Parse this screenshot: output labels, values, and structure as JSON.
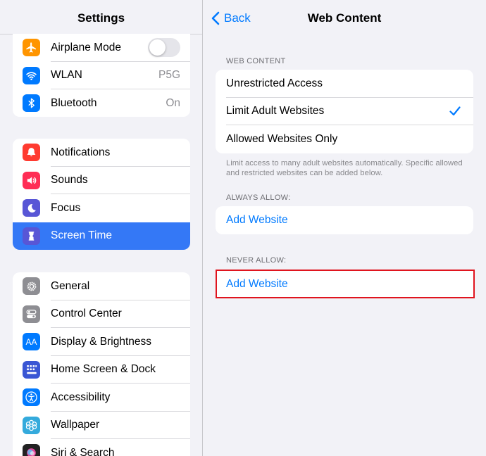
{
  "sidebar": {
    "title": "Settings",
    "groups": [
      {
        "items": [
          {
            "label": "Airplane Mode",
            "icon": "airplane-icon",
            "color": "#ff9500",
            "control": "toggle-off"
          },
          {
            "label": "WLAN",
            "icon": "wifi-icon",
            "color": "#007aff",
            "value": "P5G"
          },
          {
            "label": "Bluetooth",
            "icon": "bluetooth-icon",
            "color": "#007aff",
            "value": "On"
          }
        ]
      },
      {
        "items": [
          {
            "label": "Notifications",
            "icon": "bell-icon",
            "color": "#ff3b30"
          },
          {
            "label": "Sounds",
            "icon": "speaker-icon",
            "color": "#ff2d55"
          },
          {
            "label": "Focus",
            "icon": "moon-icon",
            "color": "#5856d6"
          },
          {
            "label": "Screen Time",
            "icon": "hourglass-icon",
            "color": "#5856d6",
            "selected": true
          }
        ]
      },
      {
        "items": [
          {
            "label": "General",
            "icon": "gear-icon",
            "color": "#8e8e93"
          },
          {
            "label": "Control Center",
            "icon": "toggles-icon",
            "color": "#8e8e93"
          },
          {
            "label": "Display & Brightness",
            "icon": "text-size-icon",
            "color": "#007aff"
          },
          {
            "label": "Home Screen & Dock",
            "icon": "grid-icon",
            "color": "#3a56d4"
          },
          {
            "label": "Accessibility",
            "icon": "accessibility-icon",
            "color": "#007aff"
          },
          {
            "label": "Wallpaper",
            "icon": "flower-icon",
            "color": "#34aadc"
          },
          {
            "label": "Siri & Search",
            "icon": "siri-icon",
            "color": "#222222"
          }
        ]
      }
    ]
  },
  "detail": {
    "back_label": "Back",
    "title": "Web Content",
    "web_content_header": "WEB CONTENT",
    "options": [
      {
        "label": "Unrestricted Access",
        "checked": false
      },
      {
        "label": "Limit Adult Websites",
        "checked": true
      },
      {
        "label": "Allowed Websites Only",
        "checked": false
      }
    ],
    "footer_note": "Limit access to many adult websites automatically. Specific allowed and restricted websites can be added below.",
    "always_allow_header": "ALWAYS ALLOW:",
    "always_allow_add": "Add Website",
    "never_allow_header": "NEVER ALLOW:",
    "never_allow_add": "Add Website"
  },
  "colors": {
    "accent": "#007aff",
    "selection": "#3478f6",
    "highlight_border": "#e0141e"
  }
}
